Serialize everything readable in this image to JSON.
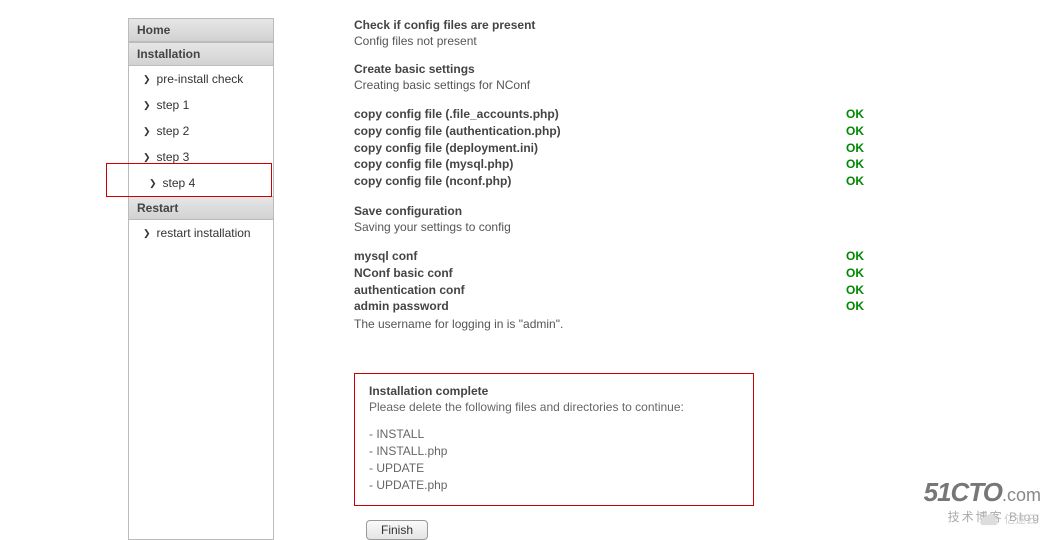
{
  "sidebar": {
    "home": "Home",
    "installation_header": "Installation",
    "items": [
      {
        "label": "pre-install check"
      },
      {
        "label": "step 1"
      },
      {
        "label": "step 2"
      },
      {
        "label": "step 3"
      },
      {
        "label": "step 4"
      }
    ],
    "restart_header": "Restart",
    "restart_item": "restart installation"
  },
  "main": {
    "check_title": "Check if config files are present",
    "check_msg": "Config files not present",
    "create_title": "Create basic settings",
    "create_msg": "Creating basic settings for NConf",
    "copy_rows": [
      {
        "label": "copy config file (.file_accounts.php)",
        "status": "OK"
      },
      {
        "label": "copy config file (authentication.php)",
        "status": "OK"
      },
      {
        "label": "copy config file (deployment.ini)",
        "status": "OK"
      },
      {
        "label": "copy config file (mysql.php)",
        "status": "OK"
      },
      {
        "label": "copy config file (nconf.php)",
        "status": "OK"
      }
    ],
    "save_title": "Save configuration",
    "save_msg": "Saving your settings to config",
    "conf_rows": [
      {
        "label": "mysql conf",
        "status": "OK"
      },
      {
        "label": "NConf basic conf",
        "status": "OK"
      },
      {
        "label": "authentication conf",
        "status": "OK"
      },
      {
        "label": "admin password",
        "status": "OK"
      }
    ],
    "login_note": "The username for logging in is \"admin\".",
    "complete": {
      "title": "Installation complete",
      "msg": "Please delete the following files and directories to continue:",
      "files": [
        "- INSTALL",
        "- INSTALL.php",
        "- UPDATE",
        "- UPDATE.php"
      ]
    },
    "finish_label": "Finish"
  },
  "watermark": {
    "brand": "51CTO",
    "dotcom": ".com",
    "sub": "技术博客 Blog",
    "alt": "亿速云"
  }
}
